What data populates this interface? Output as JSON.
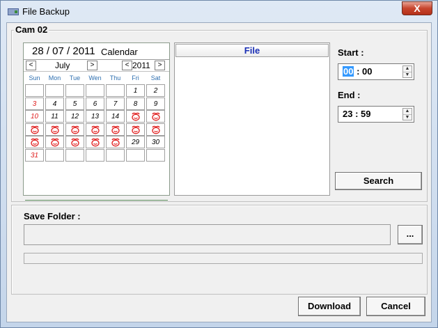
{
  "window": {
    "title": "File Backup",
    "close_glyph": "X"
  },
  "group": {
    "title": "Cam 02"
  },
  "calendar": {
    "date_display": "28 / 07 / 2011",
    "label": "Calendar",
    "month_prev": "<",
    "month": "July",
    "month_next": ">",
    "year_prev": "<",
    "year": "2011",
    "year_next": ">",
    "weekdays": [
      "Sun",
      "Mon",
      "Tue",
      "Wen",
      "Thu",
      "Fri",
      "Sat"
    ],
    "weeks": [
      [
        "",
        "",
        "",
        "",
        "",
        "1",
        "2"
      ],
      [
        "3",
        "4",
        "5",
        "6",
        "7",
        "8",
        "9"
      ],
      [
        "10",
        "11",
        "12",
        "13",
        "14",
        "*",
        "*"
      ],
      [
        "*",
        "*",
        "*",
        "*",
        "*",
        "*",
        "*"
      ],
      [
        "*",
        "*",
        "*",
        "*",
        "*",
        "29",
        "30"
      ],
      [
        "31",
        "",
        "",
        "",
        "",
        "",
        ""
      ]
    ]
  },
  "filelist": {
    "header": "File"
  },
  "start": {
    "label": "Start :",
    "hour": "00",
    "sep": " : ",
    "minute": "00"
  },
  "end": {
    "label": "End :",
    "time": "23 : 59"
  },
  "buttons": {
    "search": "Search",
    "browse": "...",
    "download": "Download",
    "cancel": "Cancel"
  },
  "save": {
    "label": "Save Folder :",
    "path": ""
  },
  "icons": {
    "recorded_day": "red-recording-face-icon"
  }
}
